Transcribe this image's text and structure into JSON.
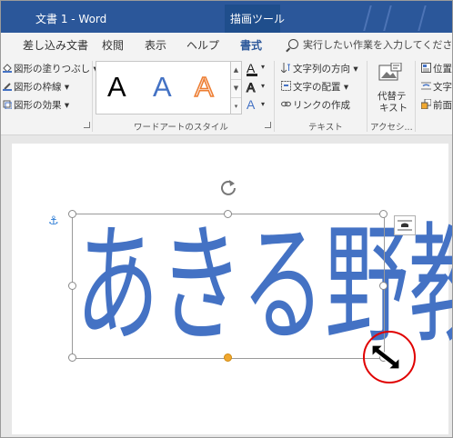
{
  "titlebar": {
    "doc_title": "文書 1  -  Word",
    "tool_tab": "描画ツール"
  },
  "tabs": {
    "items": [
      "差し込み文書",
      "校閲",
      "表示",
      "ヘルプ",
      "書式"
    ],
    "active": "書式",
    "tell_me": "実行したい作業を入力してください"
  },
  "ribbon": {
    "shape_styles": {
      "fill": "図形の塗りつぶし",
      "outline": "図形の枠線",
      "effects": "図形の効果"
    },
    "wordart_styles": {
      "label": "ワードアートのスタイル",
      "samples": [
        "A",
        "A",
        "A"
      ]
    },
    "text": {
      "direction": "文字列の方向",
      "align": "文字の配置",
      "link": "リンクの作成",
      "label": "テキスト"
    },
    "accessibility": {
      "alt_text_line1": "代替テ",
      "alt_text_line2": "キスト",
      "label": "アクセシ..."
    },
    "arrange": {
      "position": "位置",
      "wrap": "文字",
      "forward": "前面"
    }
  },
  "document": {
    "wordart_text": "あきる野教室"
  },
  "colors": {
    "titlebar": "#2b579a",
    "wordart_fill": "#4472c4",
    "highlight_circle": "#e00000"
  }
}
